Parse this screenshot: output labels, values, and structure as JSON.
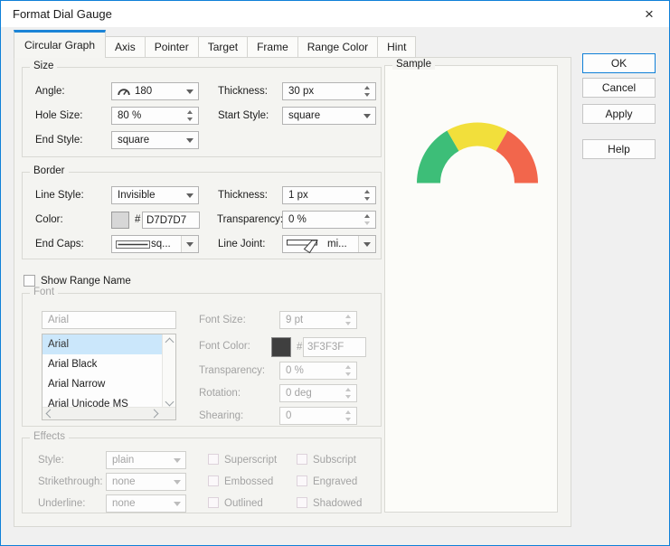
{
  "window": {
    "title": "Format Dial Gauge",
    "close_glyph": "×"
  },
  "tabs": [
    {
      "label": "Circular Graph",
      "active": true
    },
    {
      "label": "Axis"
    },
    {
      "label": "Pointer"
    },
    {
      "label": "Target"
    },
    {
      "label": "Frame"
    },
    {
      "label": "Range Color"
    },
    {
      "label": "Hint"
    }
  ],
  "buttons": {
    "ok": "OK",
    "cancel": "Cancel",
    "apply": "Apply",
    "help": "Help"
  },
  "size_section": {
    "title": "Size",
    "angle_label": "Angle:",
    "angle_value": "180",
    "thickness_label": "Thickness:",
    "thickness_value": "30 px",
    "hole_size_label": "Hole Size:",
    "hole_size_value": "80 %",
    "start_style_label": "Start Style:",
    "start_style_value": "square",
    "end_style_label": "End Style:",
    "end_style_value": "square"
  },
  "border_section": {
    "title": "Border",
    "line_style_label": "Line Style:",
    "line_style_value": "Invisible",
    "thickness_label": "Thickness:",
    "thickness_value": "1 px",
    "color_label": "Color:",
    "color_hash": "#",
    "color_value": "D7D7D7",
    "color_swatch": "#D7D7D7",
    "transparency_label": "Transparency:",
    "transparency_value": "0 %",
    "end_caps_label": "End Caps:",
    "end_caps_value": "sq...",
    "line_joint_label": "Line Joint:",
    "line_joint_value": "mi..."
  },
  "range_name": {
    "label": "Show Range Name",
    "checked": false
  },
  "font_section": {
    "title": "Font",
    "family_value": "Arial",
    "font_list": [
      "Arial",
      "Arial Black",
      "Arial Narrow",
      "Arial Unicode MS"
    ],
    "selected_font": "Arial",
    "font_size_label": "Font Size:",
    "font_size_value": "9 pt",
    "font_color_label": "Font Color:",
    "font_color_hash": "#",
    "font_color_value": "3F3F3F",
    "font_color_swatch": "#3F3F3F",
    "transparency_label": "Transparency:",
    "transparency_value": "0 %",
    "rotation_label": "Rotation:",
    "rotation_value": "0 deg",
    "shearing_label": "Shearing:",
    "shearing_value": "0"
  },
  "effects_section": {
    "title": "Effects",
    "style_label": "Style:",
    "style_value": "plain",
    "strikethrough_label": "Strikethrough:",
    "strikethrough_value": "none",
    "underline_label": "Underline:",
    "underline_value": "none",
    "checkboxes": [
      "Superscript",
      "Subscript",
      "Embossed",
      "Engraved",
      "Outlined",
      "Shadowed"
    ]
  },
  "sample": {
    "title": "Sample",
    "gauge_segments": [
      {
        "name": "green",
        "color": "#3DBE78"
      },
      {
        "name": "yellow",
        "color": "#F2DF3B"
      },
      {
        "name": "red",
        "color": "#F2664C"
      }
    ]
  },
  "colors": {
    "accent": "#0F80D8"
  }
}
